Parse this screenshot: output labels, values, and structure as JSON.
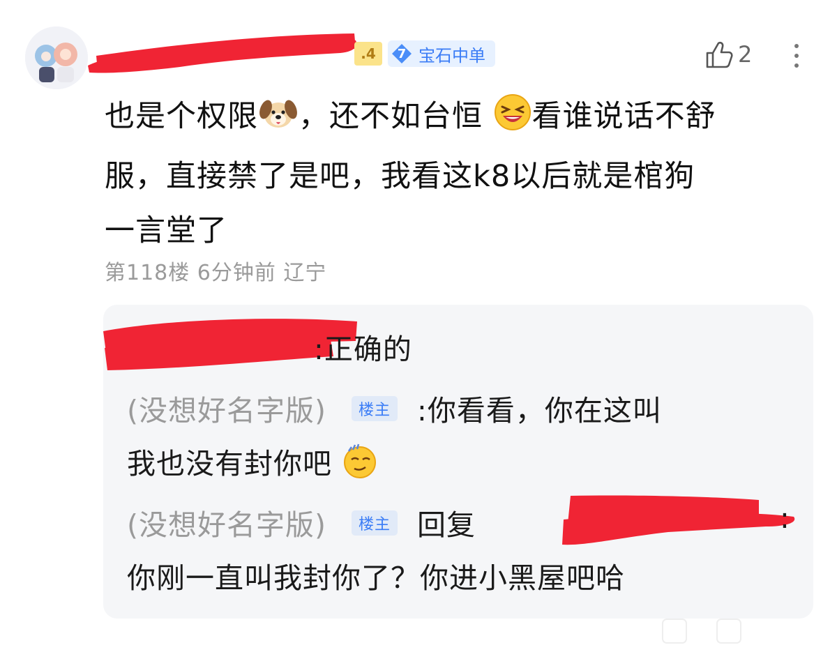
{
  "comment": {
    "level_suffix": ".4",
    "badge": {
      "number": "7",
      "label": "宝石中单"
    },
    "like_count": "2",
    "content_parts": [
      "也是个权限",
      "，还不如台恒 ",
      "看谁说话不舒",
      "服，直接禁了是吧，我看这k8以后就是棺狗",
      "一言堂了"
    ],
    "meta": "第118楼 6分钟前 辽宁"
  },
  "replies": {
    "first_text": ":正确的",
    "r1_user": "(没想好名字版)",
    "r1_tag": "楼主",
    "r1_text": ":你看看，你在这叫",
    "r1_text2": "我也没有封你吧",
    "r2_user": "(没想好名字版)",
    "r2_tag": "楼主",
    "r2_reply": "回复",
    "r2_colon": ":",
    "r2_text": "你刚一直叫我封你了？你进小黑屋吧哈"
  },
  "colors": {
    "accent": "#3a7cf6",
    "redaction": "#f02434",
    "meta_gray": "#9a9a9a",
    "reply_bg": "#f5f6f8"
  },
  "icons": [
    "dog-emoji-icon",
    "laughing-emoji-icon",
    "smirk-emoji-icon",
    "thumbs-up-icon",
    "more-options-icon",
    "diamond-rank-icon"
  ]
}
